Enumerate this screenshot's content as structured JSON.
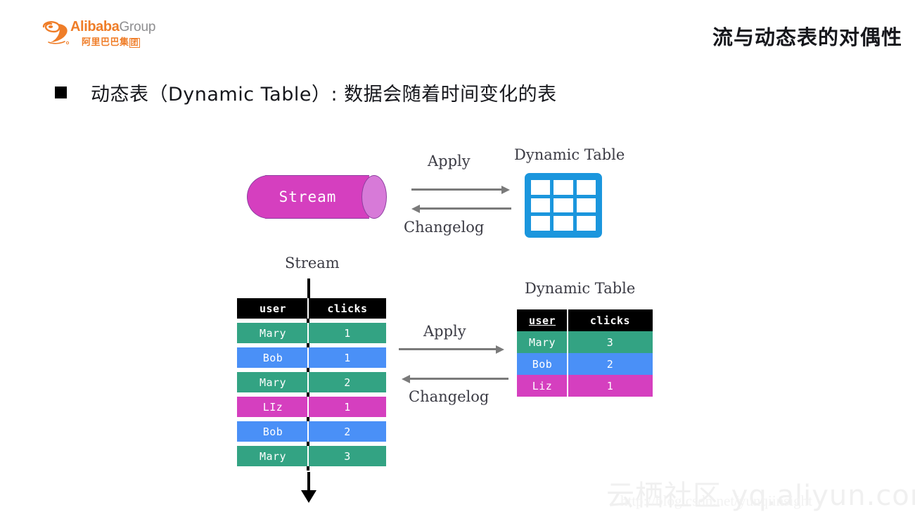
{
  "slide": {
    "title": "流与动态表的对偶性",
    "bullet": {
      "marker": "bullet-square",
      "text": "动态表（Dynamic Table）: 数据会随着时间变化的表"
    }
  },
  "logo": {
    "mark": "alibaba-swoosh-icon",
    "brand": "Alibaba",
    "suffix": "Group",
    "chinese_main": "阿里巴巴集",
    "chinese_boxed": "团",
    "brand_color": "#ef7d28",
    "suffix_color": "#8e8e90"
  },
  "top_diagram": {
    "stream_label": "Stream",
    "table_label": "Dynamic Table",
    "forward_arrow_label": "Apply",
    "backward_arrow_label": "Changelog",
    "cylinder_color": "#d53fbf",
    "cylinder_cap_color": "#d77ad8",
    "cylinder_outline_color": "#8e3fa0",
    "table_icon_color": "#1b96dd",
    "table_icon_cells": 9,
    "arrow_color": "#7a7a7a"
  },
  "bottom_diagram": {
    "forward_arrow_label": "Apply",
    "backward_arrow_label": "Changelog",
    "stream": {
      "heading": "Stream",
      "columns": [
        "user",
        "clicks"
      ],
      "header_bg": "#000000",
      "rows": [
        {
          "user": "Mary",
          "clicks": "1",
          "color": "#33a383"
        },
        {
          "user": "Bob",
          "clicks": "1",
          "color": "#4a90f7"
        },
        {
          "user": "Mary",
          "clicks": "2",
          "color": "#33a383"
        },
        {
          "user": "LIz",
          "clicks": "1",
          "color": "#d53fbf"
        },
        {
          "user": "Bob",
          "clicks": "2",
          "color": "#4a90f7"
        },
        {
          "user": "Mary",
          "clicks": "3",
          "color": "#33a383"
        }
      ]
    },
    "dynamic_table": {
      "heading": "Dynamic Table",
      "columns": [
        "user",
        "clicks"
      ],
      "key_column": "user",
      "header_bg": "#000000",
      "rows": [
        {
          "user": "Mary",
          "clicks": "3",
          "color": "#33a383"
        },
        {
          "user": "Bob",
          "clicks": "2",
          "color": "#4a90f7"
        },
        {
          "user": "Liz",
          "clicks": "1",
          "color": "#d53fbf"
        }
      ]
    }
  },
  "watermark": {
    "main": "云栖社区 yq.aliyun.com",
    "sub": "http://blog.csdn.net/yunqiinsight"
  }
}
